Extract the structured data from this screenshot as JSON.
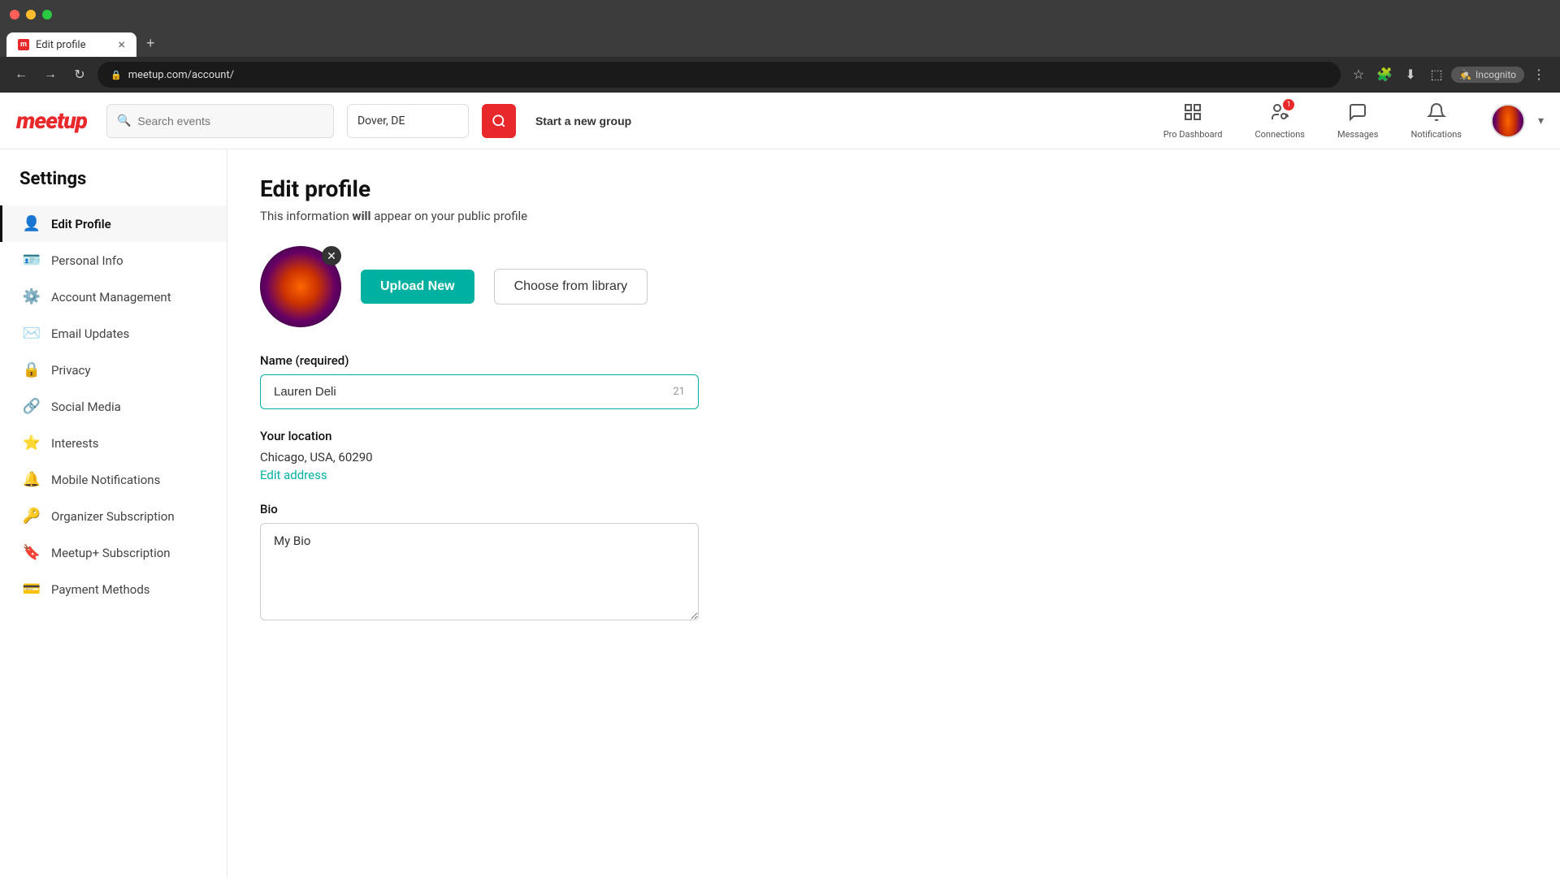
{
  "browser": {
    "tab_title": "Edit profile",
    "url": "meetup.com/account/",
    "new_tab_label": "+",
    "incognito_label": "Incognito"
  },
  "nav": {
    "logo": "meetup",
    "search_placeholder": "Search events",
    "location": "Dover, DE",
    "start_group": "Start a new group",
    "pro_dashboard": "Pro Dashboard",
    "connections": "Connections",
    "messages": "Messages",
    "notifications": "Notifications"
  },
  "sidebar": {
    "title": "Settings",
    "items": [
      {
        "id": "edit-profile",
        "label": "Edit Profile",
        "icon": "👤",
        "active": true
      },
      {
        "id": "personal-info",
        "label": "Personal Info",
        "icon": "🪪",
        "active": false
      },
      {
        "id": "account-management",
        "label": "Account Management",
        "icon": "⚙️",
        "active": false
      },
      {
        "id": "email-updates",
        "label": "Email Updates",
        "icon": "✉️",
        "active": false
      },
      {
        "id": "privacy",
        "label": "Privacy",
        "icon": "🔒",
        "active": false
      },
      {
        "id": "social-media",
        "label": "Social Media",
        "icon": "🔗",
        "active": false
      },
      {
        "id": "interests",
        "label": "Interests",
        "icon": "⭐",
        "active": false
      },
      {
        "id": "mobile-notifications",
        "label": "Mobile Notifications",
        "icon": "🔔",
        "active": false
      },
      {
        "id": "organizer-subscription",
        "label": "Organizer Subscription",
        "icon": "🔑",
        "active": false
      },
      {
        "id": "meetup-subscription",
        "label": "Meetup+ Subscription",
        "icon": "🔖",
        "active": false
      },
      {
        "id": "payment-methods",
        "label": "Payment Methods",
        "icon": "💳",
        "active": false
      }
    ]
  },
  "page": {
    "title": "Edit profile",
    "subtitle_plain": "This information ",
    "subtitle_bold": "will",
    "subtitle_rest": " appear on your public profile",
    "upload_btn": "Upload New",
    "library_btn": "Choose from library",
    "name_label": "Name (required)",
    "name_value": "Lauren Deli",
    "name_char_count": "21",
    "location_label": "Your location",
    "location_value": "Chicago, USA, 60290",
    "edit_address": "Edit address",
    "bio_label": "Bio",
    "bio_value": "My Bio"
  }
}
